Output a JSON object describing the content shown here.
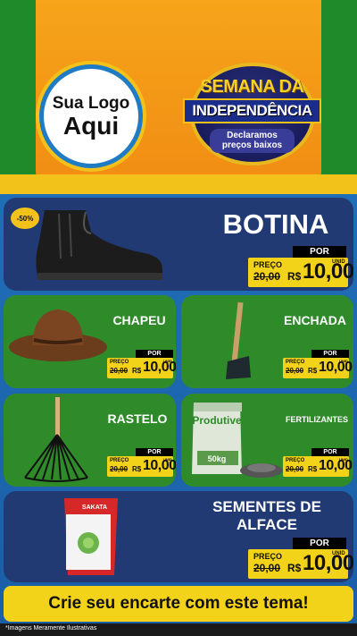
{
  "logo": {
    "line1": "Sua Logo",
    "line2": "Aqui"
  },
  "seal": {
    "line1": "SEMANA DA",
    "line2": "INDEPENDÊNCIA",
    "line3": "Declaramos preços baixos"
  },
  "products": [
    {
      "name": "BOTINA",
      "discount": "-50%",
      "preco_label": "PREÇO",
      "old_price": "20,00",
      "por_label": "POR",
      "currency": "R$",
      "price": "10,00",
      "unit": "UNID",
      "icon": "boot-icon"
    },
    {
      "name": "CHAPEU",
      "preco_label": "PREÇO",
      "old_price": "20,00",
      "por_label": "POR",
      "currency": "R$",
      "price": "10,00",
      "unit": "UNID",
      "icon": "hat-icon"
    },
    {
      "name": "ENCHADA",
      "preco_label": "PREÇO",
      "old_price": "20,00",
      "por_label": "POR",
      "currency": "R$",
      "price": "10,00",
      "unit": "UNID",
      "icon": "hoe-icon"
    },
    {
      "name": "RASTELO",
      "preco_label": "PREÇO",
      "old_price": "20,00",
      "por_label": "POR",
      "currency": "R$",
      "price": "10,00",
      "unit": "UNID",
      "icon": "rake-icon"
    },
    {
      "name": "FERTILIZANTES",
      "preco_label": "PREÇO",
      "old_price": "20,00",
      "por_label": "POR",
      "currency": "R$",
      "price": "10,00",
      "unit": "UNID",
      "icon": "fertilizer-bag-icon",
      "bag_brand": "Produtive",
      "bag_weight": "50kg"
    },
    {
      "name_line1": "SEMENTES DE",
      "name_line2": "ALFACE",
      "preco_label": "PREÇO",
      "old_price": "20,00",
      "por_label": "POR",
      "currency": "R$",
      "price": "10,00",
      "unit": "UNID",
      "icon": "seed-packet-icon",
      "packet_brand": "SAKATA"
    }
  ],
  "banner": "Crie seu encarte com este tema!",
  "footer": "*Imagens Meramente Ilustrativas"
}
